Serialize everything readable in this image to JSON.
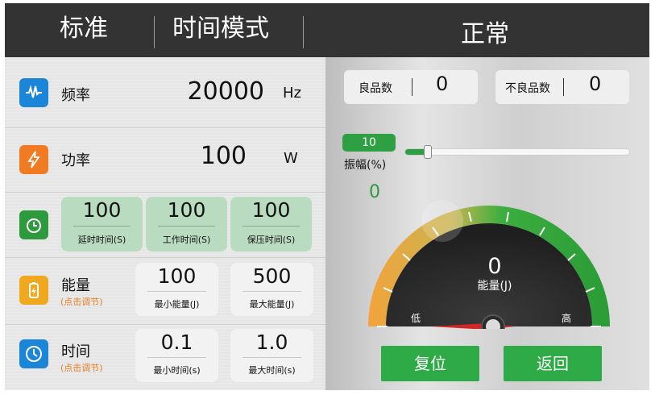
{
  "header": {
    "mode_standard": "标准",
    "mode_time": "时间模式",
    "status": "正常"
  },
  "frequency": {
    "label": "频率",
    "value": "20000",
    "unit": "Hz",
    "icon": "waveform-icon"
  },
  "power": {
    "label": "功率",
    "value": "100",
    "unit": "W",
    "icon": "lightning-icon"
  },
  "timers": {
    "icon": "timer-icon",
    "items": [
      {
        "value": "100",
        "caption": "延时时间(S)"
      },
      {
        "value": "100",
        "caption": "工作时间(S)"
      },
      {
        "value": "100",
        "caption": "保压时间(S)"
      }
    ]
  },
  "energy": {
    "label": "能量",
    "hint": "(点击调节)",
    "icon": "battery-icon",
    "min": {
      "value": "100",
      "caption": "最小能量(J)"
    },
    "max": {
      "value": "500",
      "caption": "最大能量(J)"
    }
  },
  "time": {
    "label": "时间",
    "hint": "(点击调节)",
    "icon": "clock-icon",
    "min": {
      "value": "0.1",
      "caption": "最小时间(s)"
    },
    "max": {
      "value": "1.0",
      "caption": "最大时间(s)"
    }
  },
  "counters": {
    "good_label": "良品数",
    "good_value": "0",
    "bad_label": "不良品数",
    "bad_value": "0"
  },
  "amplitude": {
    "badge": "10",
    "label": "振幅(%)",
    "value": "0",
    "slider_fraction": 0.1
  },
  "gauge": {
    "value": "0",
    "label": "能量(J)",
    "low": "低",
    "high": "高"
  },
  "buttons": {
    "reset": "复位",
    "back": "返回"
  },
  "colors": {
    "accent_green": "#2eab46",
    "header_bg": "#333333",
    "hint_orange": "#e67e22"
  }
}
